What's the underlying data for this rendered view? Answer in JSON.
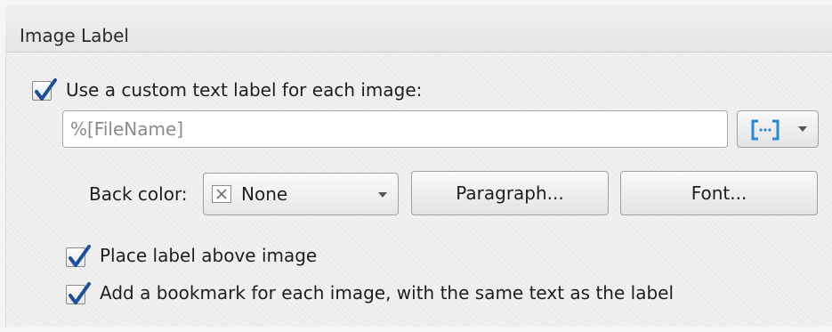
{
  "group": {
    "title": "Image Label"
  },
  "custom_label": {
    "checkbox_label": "Use a custom text label for each image:",
    "checked": true,
    "text_value": "%[FileName]"
  },
  "field_button": {
    "icon": "insert-field-icon",
    "accent": "#2a88d8"
  },
  "back_color": {
    "label": "Back color:",
    "value": "None",
    "swatch_icon": "none-x-icon"
  },
  "buttons": {
    "paragraph": "Paragraph...",
    "font": "Font..."
  },
  "options": [
    {
      "label": "Place label above image",
      "checked": true
    },
    {
      "label": "Add a bookmark for each image, with the same text as the label",
      "checked": true
    }
  ],
  "colors": {
    "checkmark": "#1c4f9c"
  }
}
